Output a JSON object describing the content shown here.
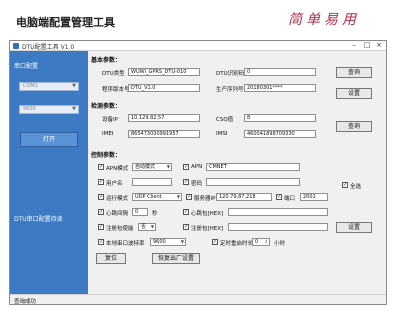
{
  "page": {
    "title": "电脑端配置管理工具",
    "brand": "简单易用"
  },
  "window": {
    "title": "DTU配置工具 V1.0",
    "min": "–",
    "max": "□",
    "close": "×"
  },
  "sidebar": {
    "serial_label": "串口配置",
    "port_value": "COM1",
    "baud_value": "9600",
    "open_button": "打开",
    "dtu_status_label": "DTU串口配置待读"
  },
  "basic": {
    "heading": "基本参数：",
    "dtu_type_label": "DTU类型",
    "dtu_type_value": "WUWI_GPRS_DTU-010",
    "dtu_id_label": "DTU识别码",
    "dtu_id_value": "0",
    "query_button": "查询",
    "firmware_label": "程序版本号",
    "firmware_value": "DTU_V1.0",
    "serial_label": "生产序列号",
    "serial_value": "20180301****",
    "set_button": "设置"
  },
  "detect": {
    "heading": "检测参数：",
    "ip_label": "设备IP",
    "ip_value": "10.129.82.57",
    "csq_label": "CSQ值",
    "csq_value": "8",
    "imei_label": "IMEI",
    "imei_value": "865473030991957",
    "imsi_label": "IMSI",
    "imsi_value": "460041898709330",
    "query_button": "查询"
  },
  "control": {
    "heading": "控制参数：",
    "apn_mode_label": "APN模式",
    "apn_mode_value": "自动模式",
    "apn_label": "APN",
    "apn_value": "CMNET",
    "username_label": "用户名",
    "password_label": "密码",
    "select_all_label": "全选",
    "run_mode_label": "运行模式",
    "run_mode_value": "UDP Client",
    "server_label": "服务器IP",
    "server_value": "120.79.87.218",
    "port_label": "端口",
    "port_value": "2001",
    "heartbeat_interval_label": "心跳间隔",
    "heartbeat_interval_value": "0",
    "seconds_unit": "秒",
    "heartbeat_hex_label": "心跳包[HEX]",
    "reg_enable_label": "注册包使能",
    "reg_enable_value": "否",
    "reg_hex_label": "注册包[HEX]",
    "set_button": "设置",
    "local_baud_label": "本地串口波特率",
    "local_baud_value": "9600",
    "timed_restart_label": "定时重启时长",
    "timed_restart_value": "0",
    "hours_unit": "小时",
    "reset_button": "复位",
    "factory_button": "恢复出厂设置"
  },
  "status": {
    "text": "查询成功"
  }
}
